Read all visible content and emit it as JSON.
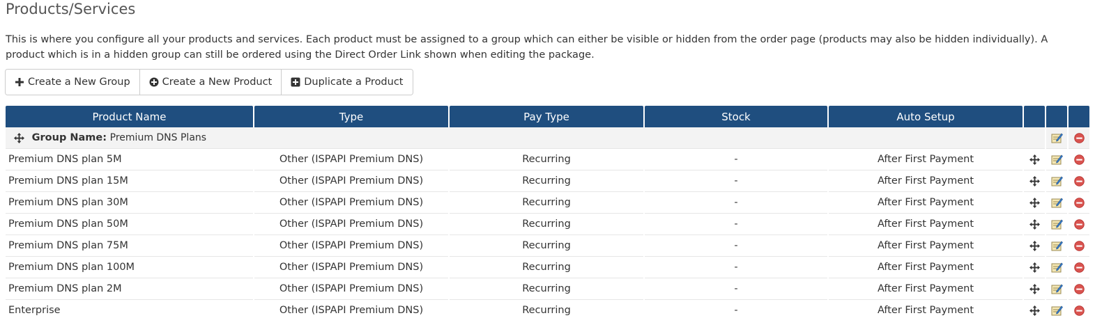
{
  "header": {
    "title": "Products/Services",
    "intro": "This is where you configure all your products and services. Each product must be assigned to a group which can either be visible or hidden from the order page (products may also be hidden individually). A product which is in a hidden group can still be ordered using the Direct Order Link shown when editing the package."
  },
  "toolbar": {
    "create_group": "Create a New Group",
    "create_product": "Create a New Product",
    "duplicate_product": "Duplicate a Product"
  },
  "table": {
    "columns": [
      "Product Name",
      "Type",
      "Pay Type",
      "Stock",
      "Auto Setup",
      "",
      "",
      ""
    ],
    "group": {
      "label": "Group Name:",
      "name": "Premium DNS Plans"
    },
    "rows": [
      {
        "name": "Premium DNS plan 5M",
        "type": "Other (ISPAPI Premium DNS)",
        "pay_type": "Recurring",
        "stock": "-",
        "auto_setup": "After First Payment"
      },
      {
        "name": "Premium DNS plan 15M",
        "type": "Other (ISPAPI Premium DNS)",
        "pay_type": "Recurring",
        "stock": "-",
        "auto_setup": "After First Payment"
      },
      {
        "name": "Premium DNS plan 30M",
        "type": "Other (ISPAPI Premium DNS)",
        "pay_type": "Recurring",
        "stock": "-",
        "auto_setup": "After First Payment"
      },
      {
        "name": "Premium DNS plan 50M",
        "type": "Other (ISPAPI Premium DNS)",
        "pay_type": "Recurring",
        "stock": "-",
        "auto_setup": "After First Payment"
      },
      {
        "name": "Premium DNS plan 75M",
        "type": "Other (ISPAPI Premium DNS)",
        "pay_type": "Recurring",
        "stock": "-",
        "auto_setup": "After First Payment"
      },
      {
        "name": "Premium DNS plan 100M",
        "type": "Other (ISPAPI Premium DNS)",
        "pay_type": "Recurring",
        "stock": "-",
        "auto_setup": "After First Payment"
      },
      {
        "name": "Premium DNS plan 2M",
        "type": "Other (ISPAPI Premium DNS)",
        "pay_type": "Recurring",
        "stock": "-",
        "auto_setup": "After First Payment"
      },
      {
        "name": "Enterprise",
        "type": "Other (ISPAPI Premium DNS)",
        "pay_type": "Recurring",
        "stock": "-",
        "auto_setup": "After First Payment"
      }
    ]
  },
  "icons": {
    "move": "move-icon",
    "edit": "edit-icon",
    "delete": "delete-icon",
    "plus": "plus-icon",
    "plus_circle": "plus-circle-icon",
    "plus_square": "plus-square-icon"
  },
  "colors": {
    "header_bg": "#1f4e7f",
    "group_bg": "#f3f3f3",
    "delete_red": "#d9534f"
  }
}
